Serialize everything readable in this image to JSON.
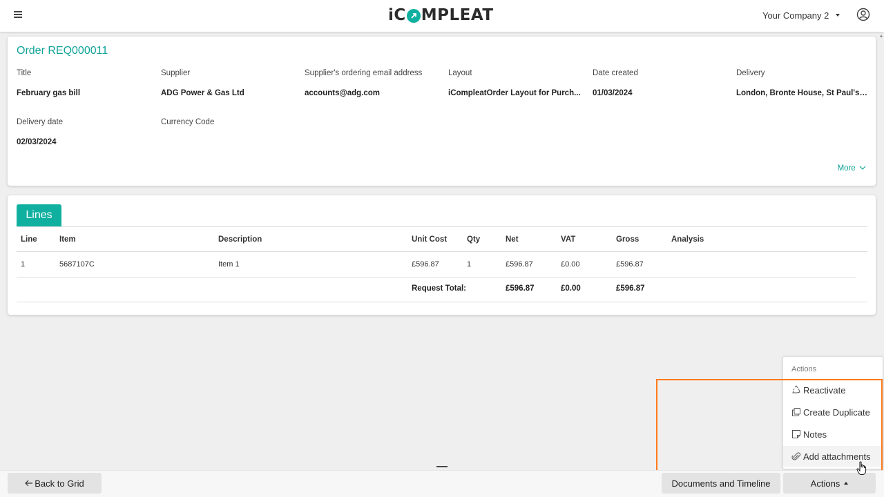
{
  "header": {
    "logo_pre": "iC",
    "logo_post": "MPLEAT",
    "company": "Your Company 2"
  },
  "order": {
    "title": "Order REQ000011",
    "fields": [
      {
        "label": "Title",
        "value": "February gas bill"
      },
      {
        "label": "Supplier",
        "value": "ADG Power & Gas Ltd"
      },
      {
        "label": "Supplier's ordering email address",
        "value": "accounts@adg.com"
      },
      {
        "label": "Layout",
        "value": "iCompleatOrder Layout for Purch..."
      },
      {
        "label": "Date created",
        "value": "01/03/2024"
      },
      {
        "label": "Delivery",
        "value": "London, Bronte House, St Paul's P..."
      },
      {
        "label": "Delivery date",
        "value": "02/03/2024"
      },
      {
        "label": "Currency Code",
        "value": ""
      }
    ],
    "more": "More"
  },
  "lines": {
    "tab": "Lines",
    "columns": [
      "Line",
      "Item",
      "Description",
      "Unit Cost",
      "Qty",
      "Net",
      "VAT",
      "Gross",
      "Analysis"
    ],
    "rows": [
      {
        "line": "1",
        "item": "5687107C",
        "description": "Item 1",
        "unit_cost": "£596.87",
        "qty": "1",
        "net": "£596.87",
        "vat": "£0.00",
        "gross": "£596.87",
        "analysis": ""
      }
    ],
    "total": {
      "label": "Request Total:",
      "net": "£596.87",
      "vat": "£0.00",
      "gross": "£596.87"
    }
  },
  "actions_menu": {
    "header": "Actions",
    "items": [
      {
        "label": "Reactivate",
        "icon": "recycle-icon"
      },
      {
        "label": "Create Duplicate",
        "icon": "duplicate-icon"
      },
      {
        "label": "Notes",
        "icon": "note-icon"
      },
      {
        "label": "Add attachments",
        "icon": "paperclip-icon"
      }
    ]
  },
  "footer": {
    "back": "Back to Grid",
    "docs": "Documents and Timeline",
    "actions": "Actions"
  },
  "colors": {
    "accent": "#10b0a0",
    "annotation": "#f26f1c"
  }
}
